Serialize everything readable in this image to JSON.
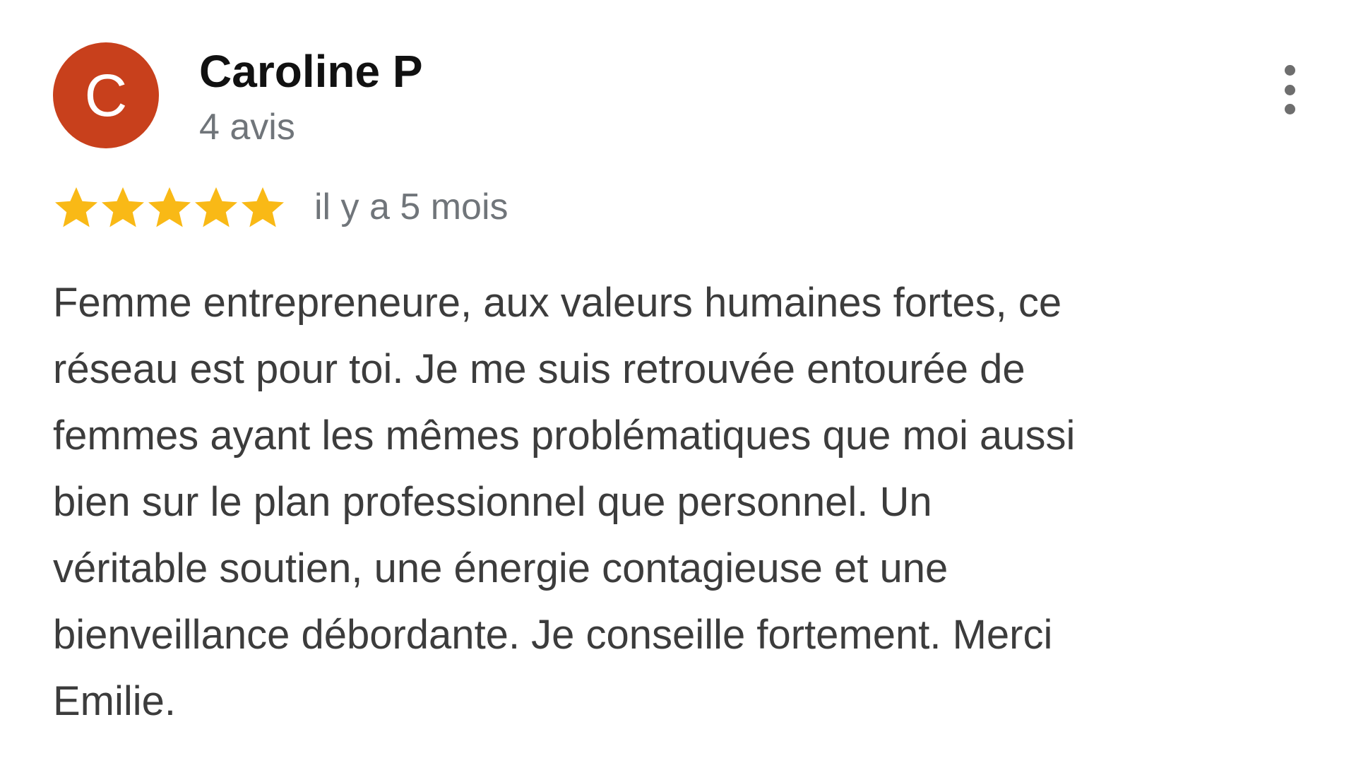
{
  "author": {
    "initial": "C",
    "name": "Caroline P",
    "review_count": "4 avis",
    "avatar_color": "#c8401c"
  },
  "rating": {
    "stars": 5,
    "max_stars": 5,
    "star_color": "#f9b916",
    "date": "il y a 5 mois"
  },
  "menu": {
    "icon": "more-vert-icon"
  },
  "review": {
    "lines": [
      "Femme entrepreneure, aux valeurs humaines fortes, ce",
      "réseau est pour toi. Je me suis retrouvée entourée de",
      "femmes ayant les mêmes problématiques que moi aussi",
      "bien sur le plan professionnel que personnel. Un",
      "véritable soutien, une énergie contagieuse et une",
      "bienveillance débordante. Je conseille fortement. Merci",
      "Emilie."
    ]
  }
}
